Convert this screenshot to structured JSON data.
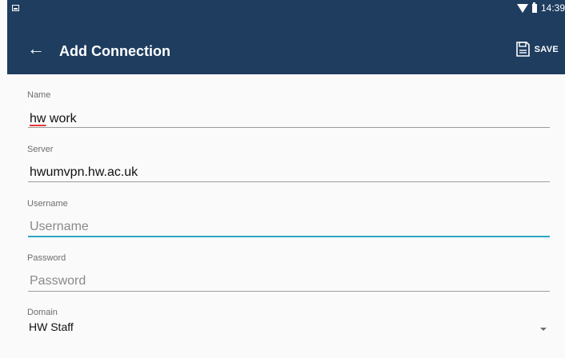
{
  "status_bar": {
    "time": "14:39"
  },
  "app_bar": {
    "title": "Add Connection",
    "save_label": "SAVE"
  },
  "form": {
    "name": {
      "label": "Name",
      "value_part1": "hw",
      "value_part2": " work"
    },
    "server": {
      "label": "Server",
      "value": "hwumvpn.hw.ac.uk"
    },
    "username": {
      "label": "Username",
      "placeholder": "Username"
    },
    "password": {
      "label": "Password",
      "placeholder": "Password"
    },
    "domain": {
      "label": "Domain",
      "value": "HW Staff"
    }
  },
  "colors": {
    "app_bar": "#1e3d5f",
    "focus_line": "#2fa5c6",
    "spell_underline": "#e53935"
  }
}
